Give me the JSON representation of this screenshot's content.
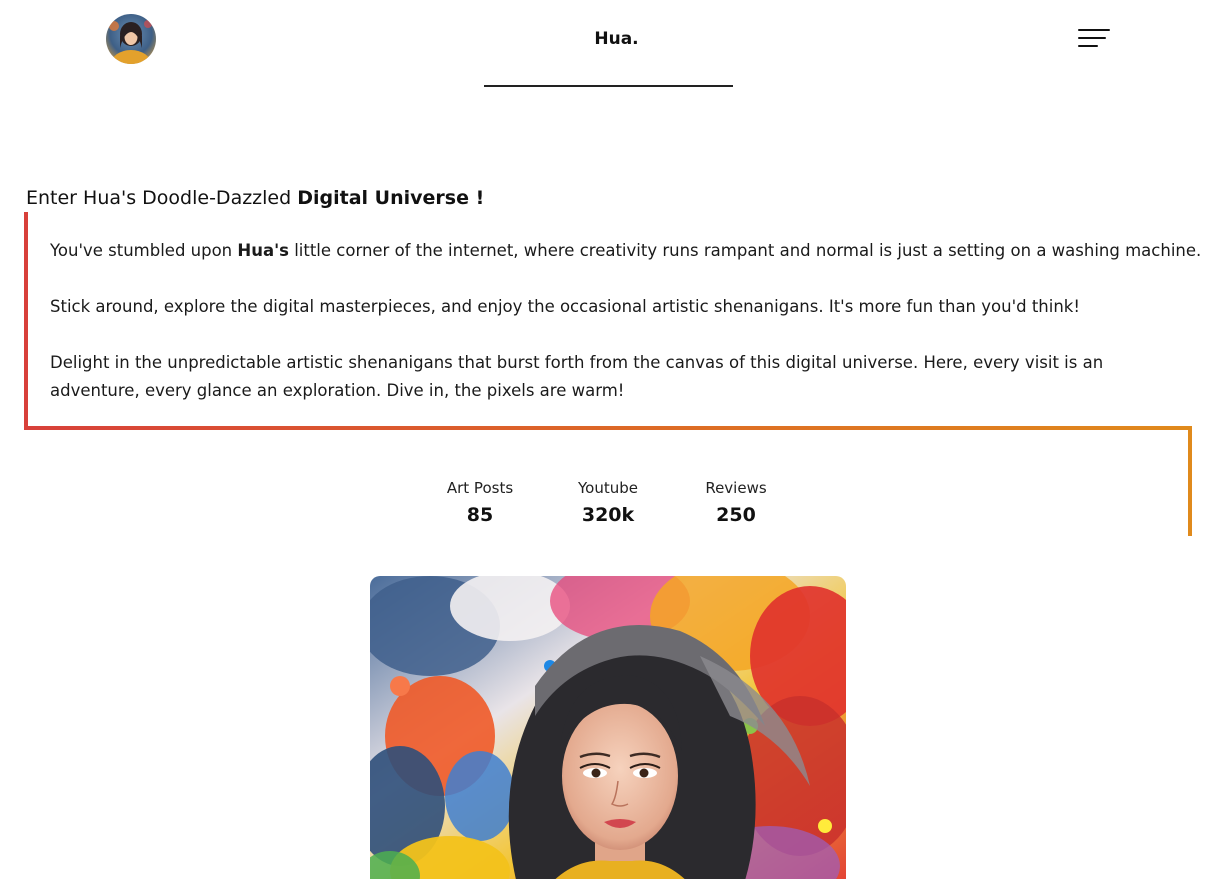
{
  "header": {
    "brand": "Hua.",
    "avatar_alt": "Hua avatar",
    "menu_icon": "hamburger-menu-icon"
  },
  "intro": {
    "title_prefix": "Enter Hua's Doodle-Dazzled ",
    "title_bold": "Digital Universe !",
    "p1_prefix": "You've stumbled upon ",
    "p1_bold": "Hua's",
    "p1_suffix": " little corner of the internet, where creativity runs rampant and normal is just a setting on a washing machine.",
    "p2": "Stick around, explore the digital masterpieces, and enjoy the occasional artistic shenanigans. It's more fun than you'd think!",
    "p3": "Delight in the unpredictable artistic shenanigans that burst forth from the canvas of this digital universe. Here, every visit is an adventure, every glance an exploration. Dive in, the pixels are warm!"
  },
  "stats": [
    {
      "label": "Art Posts",
      "value": "85"
    },
    {
      "label": "Youtube",
      "value": "320k"
    },
    {
      "label": "Reviews",
      "value": "250"
    }
  ],
  "hero": {
    "alt": "Colorful paint-splash portrait of Hua"
  },
  "colors": {
    "accent_red": "#d8403a",
    "accent_orange": "#e08a1c"
  }
}
